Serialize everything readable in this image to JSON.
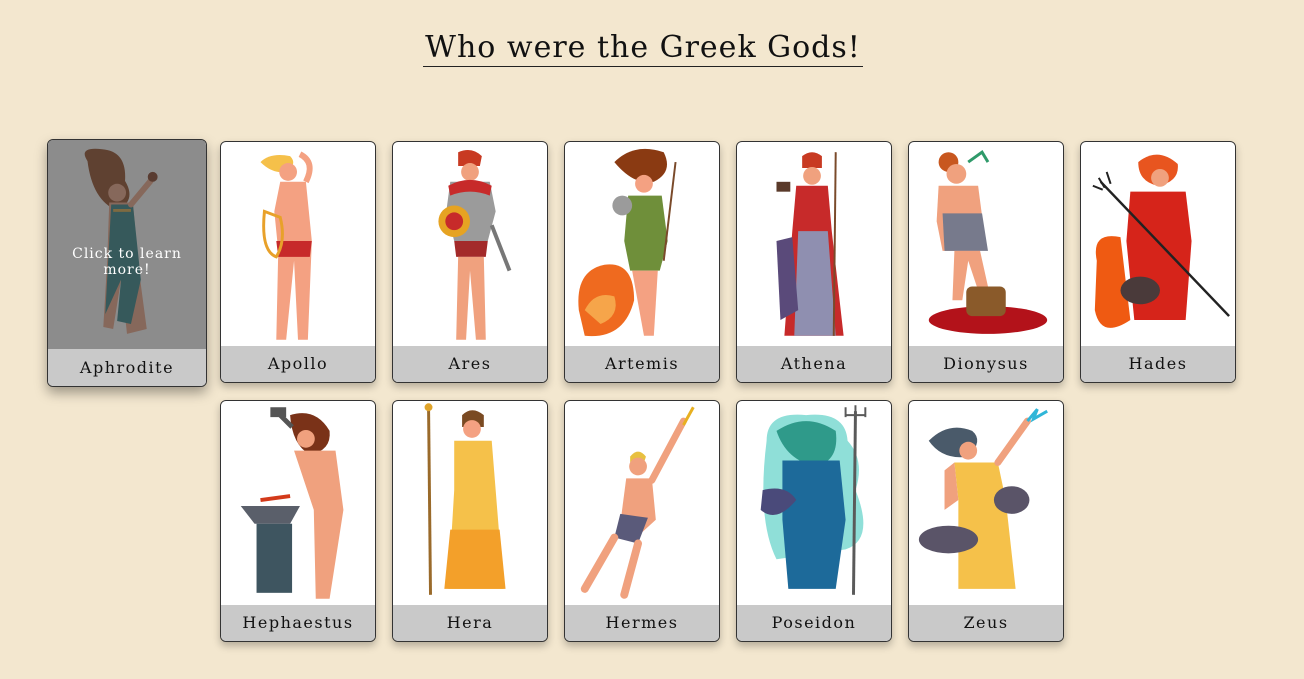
{
  "page": {
    "title": "Who were the Greek Gods!"
  },
  "hover_prompt": "Click to learn more!",
  "gods": [
    {
      "name": "Aphrodite",
      "icon": "aphrodite-illustration",
      "hovered": true
    },
    {
      "name": "Apollo",
      "icon": "apollo-illustration"
    },
    {
      "name": "Ares",
      "icon": "ares-illustration"
    },
    {
      "name": "Artemis",
      "icon": "artemis-illustration"
    },
    {
      "name": "Athena",
      "icon": "athena-illustration"
    },
    {
      "name": "Dionysus",
      "icon": "dionysus-illustration"
    },
    {
      "name": "Hades",
      "icon": "hades-illustration"
    },
    {
      "name": "Hephaestus",
      "icon": "hephaestus-illustration"
    },
    {
      "name": "Hera",
      "icon": "hera-illustration"
    },
    {
      "name": "Hermes",
      "icon": "hermes-illustration"
    },
    {
      "name": "Poseidon",
      "icon": "poseidon-illustration"
    },
    {
      "name": "Zeus",
      "icon": "zeus-illustration"
    }
  ]
}
